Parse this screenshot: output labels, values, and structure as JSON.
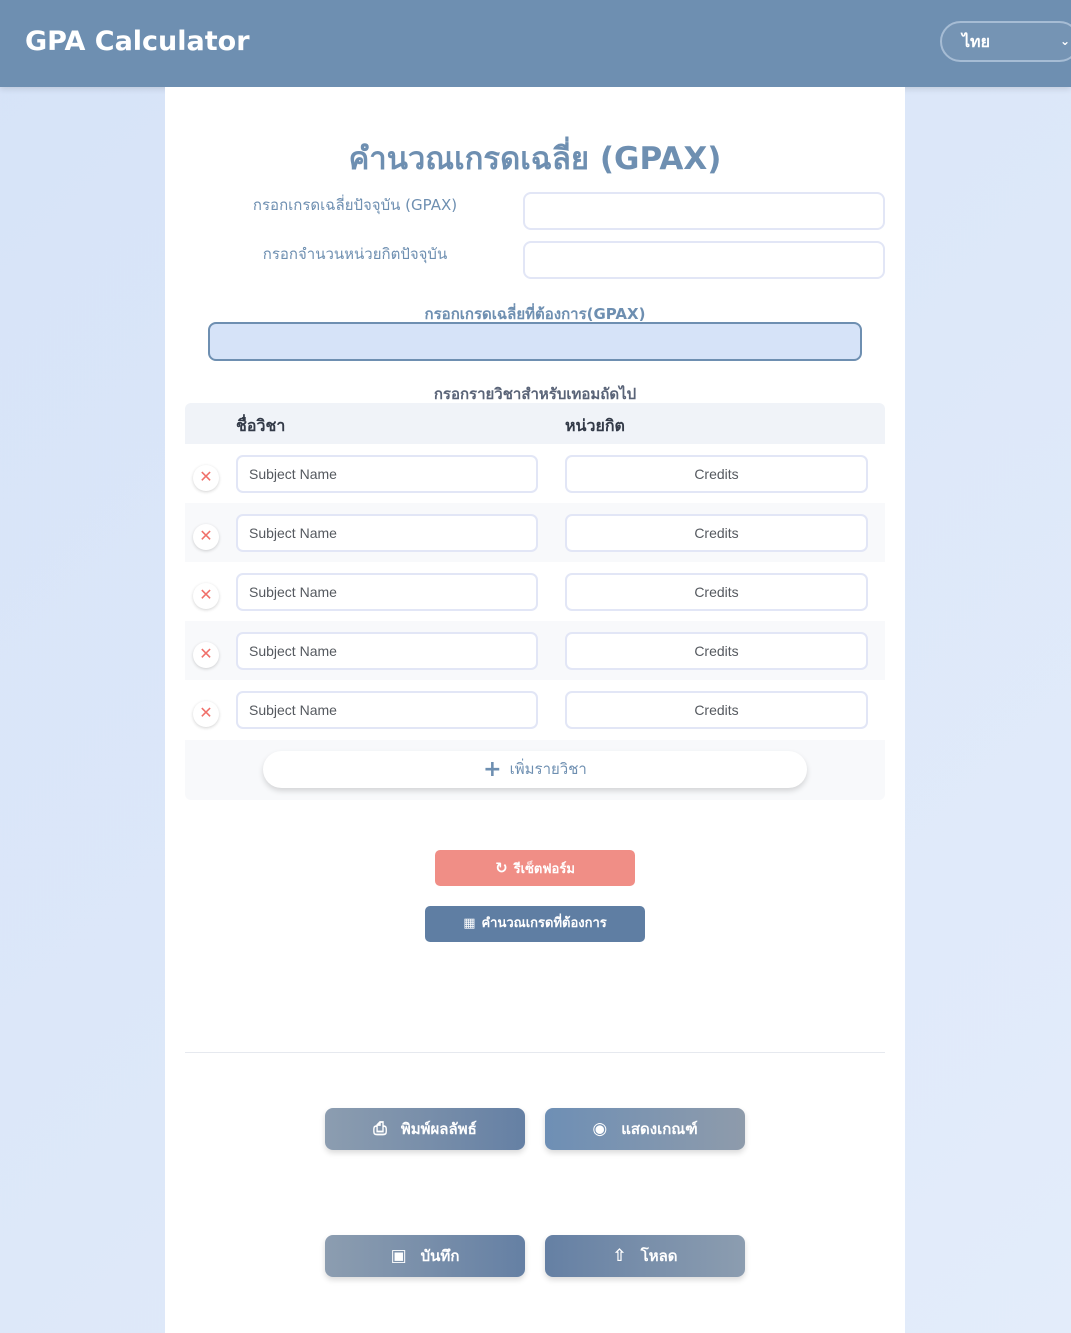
{
  "header": {
    "brand": "GPA Calculator",
    "language": "ไทย"
  },
  "main": {
    "title": "คำนวณเกรดเฉลี่ย (GPAX)",
    "current_gpax_label": "กรอกเกรดเฉลี่ยปัจจุบัน (GPAX)",
    "current_credits_label": "กรอกจำนวนหน่วยกิตปัจจุบัน",
    "target_gpax_label": "กรอกเกรดเฉลี่ยที่ต้องการ(GPAX)",
    "next_term_label": "กรอกรายวิชาสำหรับเทอมถัดไป"
  },
  "table": {
    "col_subject": "ชื่อวิชา",
    "col_credits": "หน่วยกิต",
    "rows": [
      {
        "subject_placeholder": "Subject Name",
        "credits_placeholder": "Credits"
      },
      {
        "subject_placeholder": "Subject Name",
        "credits_placeholder": "Credits"
      },
      {
        "subject_placeholder": "Subject Name",
        "credits_placeholder": "Credits"
      },
      {
        "subject_placeholder": "Subject Name",
        "credits_placeholder": "Credits"
      },
      {
        "subject_placeholder": "Subject Name",
        "credits_placeholder": "Credits"
      }
    ],
    "add_label": "เพิ่มรายวิชา",
    "delete_glyph": "✕"
  },
  "actions": {
    "reset_label": "รีเซ็ตฟอร์ม",
    "calc_label": "คำนวณเกรดที่ต้องการ",
    "print_label": "พิมพ์ผลลัพธ์",
    "show_criteria_label": "แสดงเกณฑ์",
    "save_label": "บันทึก",
    "load_label": "โหลด"
  },
  "icons": {
    "reset": "rotate-right-icon",
    "calc": "calculator-icon",
    "print": "printer-icon",
    "show": "eye-icon",
    "save": "floppy-disk-icon",
    "load": "upload-icon",
    "add": "plus-icon",
    "delete": "close-icon"
  },
  "colors": {
    "primary": "#6e8fb1",
    "danger": "#f08e86",
    "accent_light": "#d6e3f8"
  }
}
